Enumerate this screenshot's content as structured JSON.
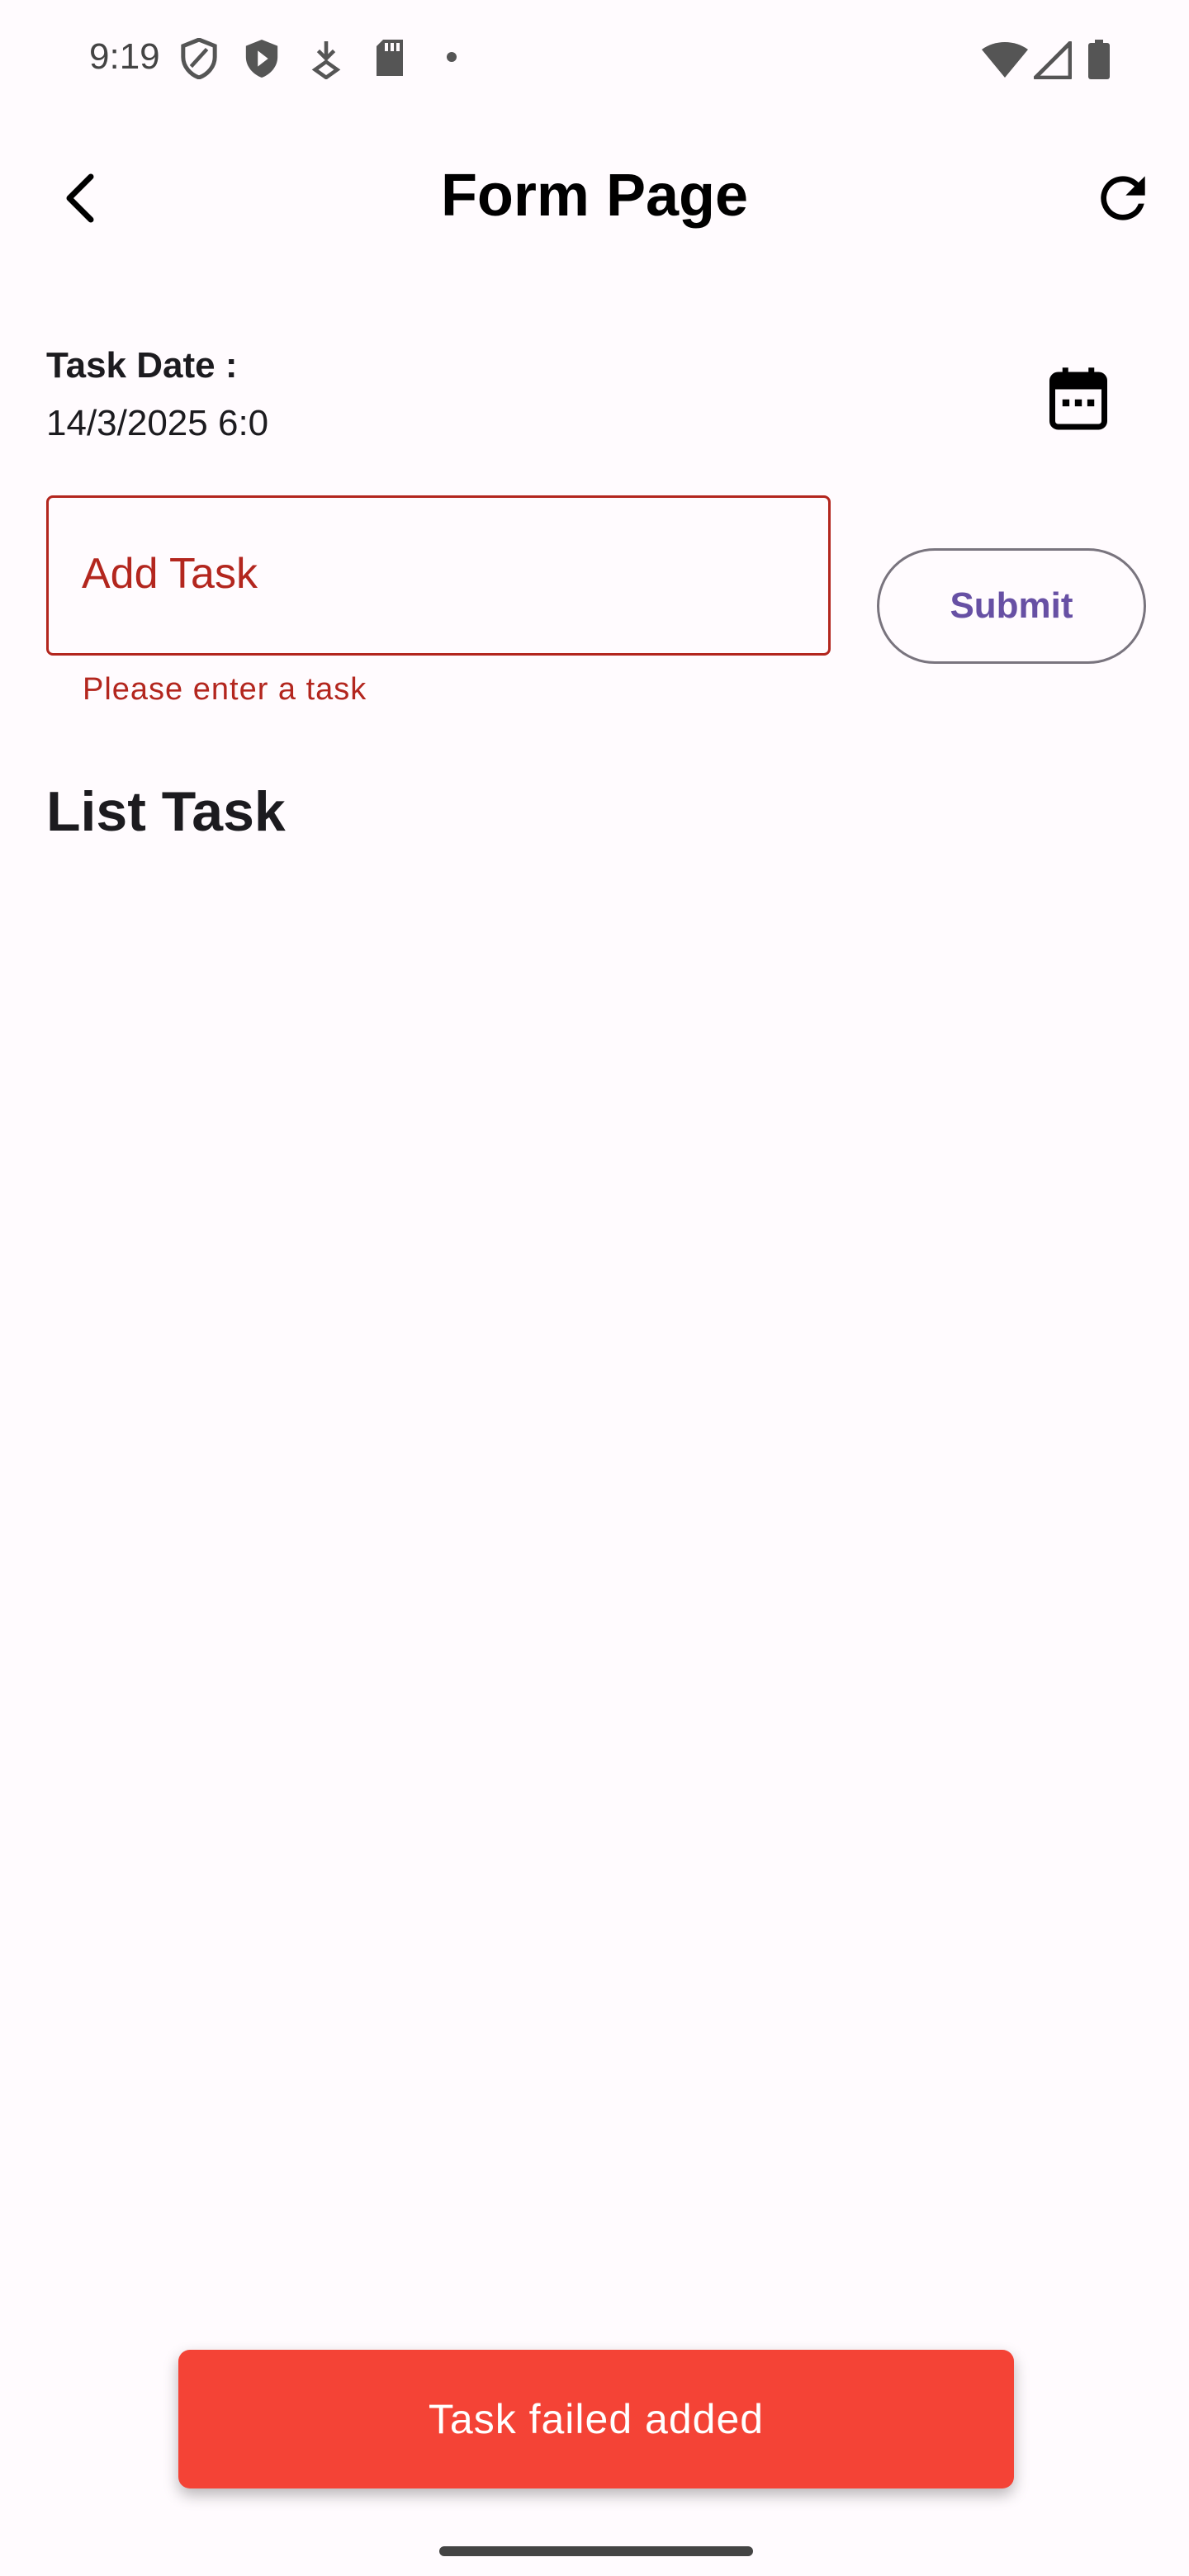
{
  "status_bar": {
    "time": "9:19",
    "left_icons": [
      "shield-outline-icon",
      "shield-play-icon",
      "download-icon",
      "sd-card-icon",
      "dot-icon"
    ],
    "right_icons": [
      "wifi-icon",
      "cell-signal-icon",
      "battery-icon"
    ]
  },
  "app_bar": {
    "title": "Form Page",
    "back_icon": "chevron-left-icon",
    "refresh_icon": "refresh-icon"
  },
  "task_date": {
    "label": "Task Date :",
    "value": "14/3/2025 6:0",
    "calendar_icon": "calendar-icon"
  },
  "task_input": {
    "placeholder": "Add Task",
    "value": "",
    "error": "Please enter a task",
    "error_color": "#b3261e"
  },
  "submit": {
    "label": "Submit",
    "color": "#6750a4"
  },
  "list": {
    "title": "List Task",
    "items": []
  },
  "snackbar": {
    "message": "Task failed added",
    "background": "#f44336"
  }
}
